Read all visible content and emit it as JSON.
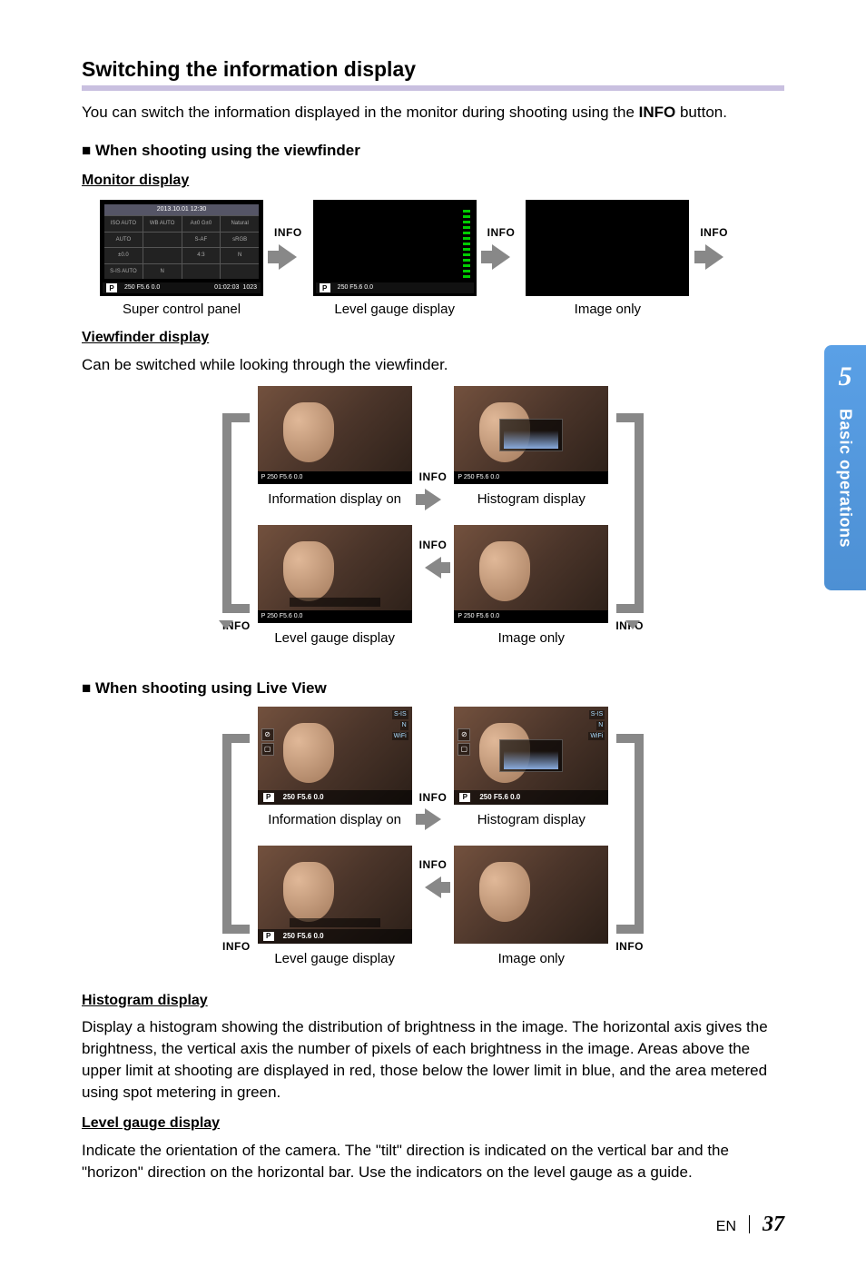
{
  "sideTab": {
    "number": "5",
    "label": "Basic operations"
  },
  "title": "Switching the information display",
  "intro": "You can switch the information displayed in the monitor during shooting using the INFO button.",
  "vfSection": "When shooting using the viewfinder",
  "lvSection": "When shooting using Live View",
  "monitorDisplay": "Monitor display",
  "viewfinderDisplay": "Viewfinder display",
  "vfIntro": "Can be switched while looking through the viewfinder.",
  "infoLabel": "INFO",
  "captions": {
    "scp": "Super control panel",
    "levelGauge": "Level gauge display",
    "imageOnly": "Image only",
    "infoOn": "Information display on",
    "histogram": "Histogram display"
  },
  "scpHeader": "2013.10.01 12:30",
  "scpBottom": "250  F5.6   0.0",
  "scpBottomTime": "01:02:03",
  "scpBottomShots": "1023",
  "lvBottomLine": "250  F5.6   0.0",
  "vfBottomLine": "P  250 F5.6  0.0",
  "histHeading": "Histogram display",
  "histBody": "Display a histogram showing the distribution of brightness in the image. The horizontal axis gives the brightness, the vertical axis the number of pixels of each brightness in the image. Areas above the upper limit at shooting are displayed in red, those below the lower limit in blue, and the area metered using spot metering in green.",
  "lgHeading": "Level gauge display",
  "lgBody": "Indicate the orientation of the camera. The \"tilt\" direction is indicated on the vertical bar and the \"horizon\" direction on the horizontal bar. Use the indicators on the level gauge as a guide.",
  "footer": {
    "lang": "EN",
    "page": "37"
  },
  "scpCells": {
    "iso": "ISO AUTO",
    "wb": "WB AUTO",
    "a0": "A±0 G±0",
    "nat": "Natural",
    "r1c1": "AUTO",
    "r1c2": "",
    "r1c3": "S-AF",
    "r1c4": "sRGB",
    "r2c1": "±0.0",
    "r2c2": "",
    "r2c3": "4:3",
    "r2c4": "N",
    "r3c1": "S-IS AUTO",
    "r3c2": "N",
    "r3c3": "",
    "r3c4": ""
  }
}
